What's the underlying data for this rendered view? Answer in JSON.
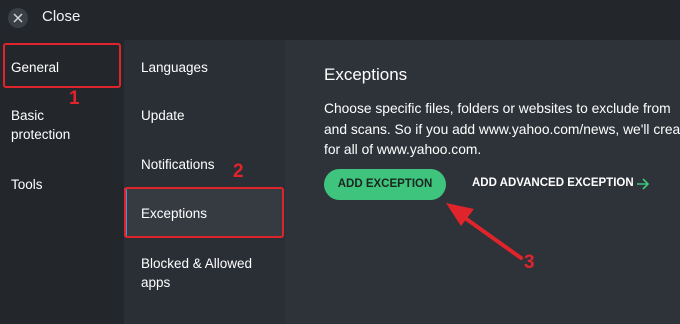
{
  "window": {
    "close_label": "Close"
  },
  "sidebar": {
    "items": [
      {
        "label": "General"
      },
      {
        "label_line1": "Basic",
        "label_line2": "protection"
      },
      {
        "label": "Tools"
      }
    ]
  },
  "submenu": {
    "items": [
      {
        "label": "Languages"
      },
      {
        "label": "Update"
      },
      {
        "label": "Notifications"
      },
      {
        "label": "Exceptions"
      },
      {
        "label_line1": "Blocked & Allowed",
        "label_line2": "apps"
      }
    ]
  },
  "main": {
    "title": "Exceptions",
    "description_lines": [
      "Choose specific files, folders or websites to exclude from",
      "and scans. So if you add www.yahoo.com/news, we'll crea",
      "for all of www.yahoo.com."
    ],
    "add_exception_label": "ADD EXCEPTION",
    "add_advanced_label": "ADD ADVANCED EXCEPTION"
  },
  "annotations": {
    "n1": "1",
    "n2": "2",
    "n3": "3"
  },
  "colors": {
    "highlight": "#e0242c",
    "accent_green": "#3ec47d",
    "active_bar": "#4f8dd0"
  }
}
